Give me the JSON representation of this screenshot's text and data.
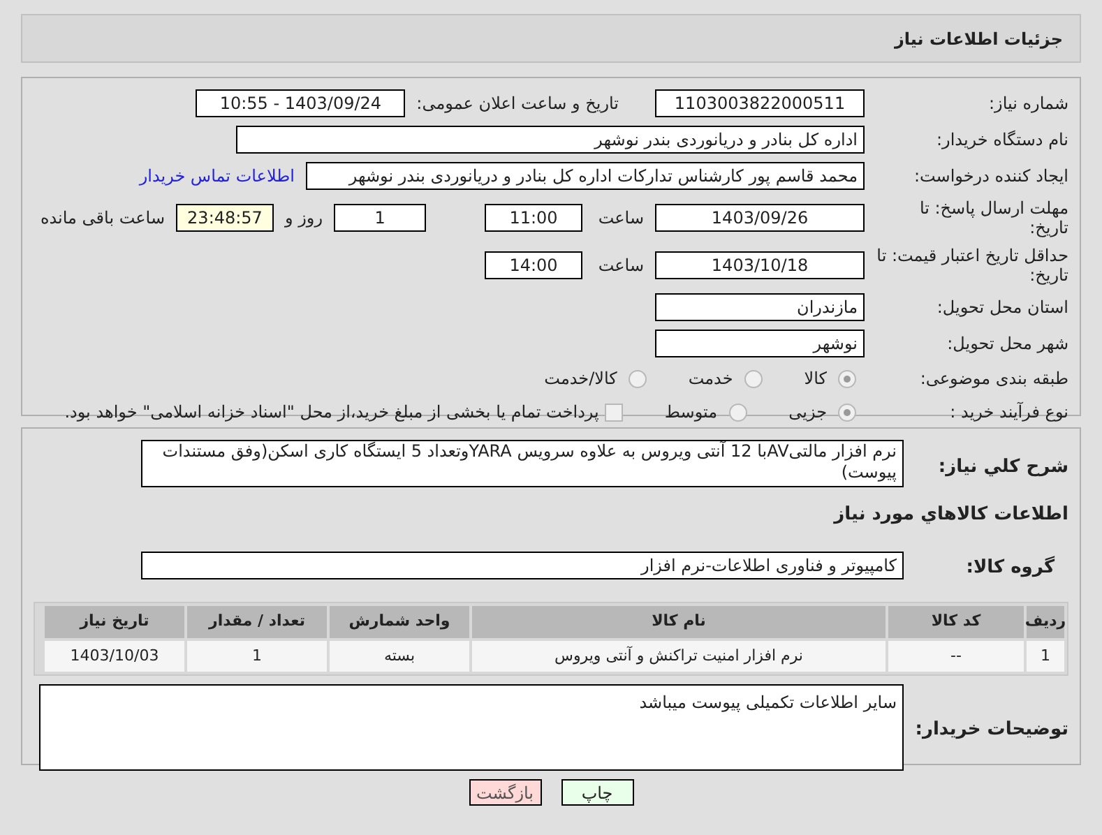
{
  "page_title": "جزئیات اطلاعات نیاز",
  "fields": {
    "need_number_label": "شماره نیاز:",
    "need_number": "1103003822000511",
    "announce_label": "تاریخ و ساعت اعلان عمومی:",
    "announce": "1403/09/24 - 10:55",
    "buyer_label": "نام دستگاه خریدار:",
    "buyer": "اداره کل بنادر و دریانوردی بندر نوشهر",
    "creator_label": "ایجاد کننده درخواست:",
    "creator": "محمد قاسم پور کارشناس تدارکات اداره کل بنادر و دریانوردی بندر نوشهر",
    "contact_link": "اطلاعات تماس خریدار",
    "deadline_label": "مهلت ارسال پاسخ: تا تاریخ:",
    "deadline_date": "1403/09/26",
    "time_label": "ساعت",
    "deadline_time": "11:00",
    "days": "1",
    "days_label": "روز و",
    "remaining": "23:48:57",
    "remaining_label": "ساعت باقی مانده",
    "validity_label": "حداقل تاریخ اعتبار قیمت: تا تاریخ:",
    "validity_date": "1403/10/18",
    "validity_time_label": "ساعت",
    "validity_time": "14:00",
    "province_label": "استان محل تحویل:",
    "province": "مازندران",
    "city_label": "شهر محل تحویل:",
    "city": "نوشهر"
  },
  "category": {
    "label": "طبقه بندی موضوعی:",
    "options": [
      {
        "label": "کالا",
        "selected": true
      },
      {
        "label": "خدمت",
        "selected": false
      },
      {
        "label": "کالا/خدمت",
        "selected": false
      }
    ]
  },
  "process": {
    "label": "نوع فرآیند خرید :",
    "options": [
      {
        "label": "جزیی",
        "selected": true
      },
      {
        "label": "متوسط",
        "selected": false
      }
    ],
    "payment_checkbox": {
      "label": "پرداخت تمام یا بخشی از مبلغ خرید،از محل \"اسناد خزانه اسلامی\" خواهد بود.",
      "checked": false
    }
  },
  "description": {
    "label": "شرح کلي نياز:",
    "value": "نرم افزار مالتیAVبا 12 آنتی ویروس به علاوه سرویس YARAوتعداد 5  ایستگاه کاری اسکن(وفق مستندات پیوست)"
  },
  "goods_heading": "اطلاعات کالاهاي مورد نياز",
  "goods_group": {
    "label": "گروه کالا:",
    "value": "کامپیوتر و فناوری اطلاعات-نرم افزار"
  },
  "table": {
    "columns": [
      "ردیف",
      "کد کالا",
      "نام کالا",
      "واحد شمارش",
      "تعداد / مقدار",
      "تاریخ نیاز"
    ],
    "rows": [
      [
        "1",
        "--",
        "نرم افزار امنیت تراکنش و آنتی ویروس",
        "بسته",
        "1",
        "1403/10/03"
      ]
    ]
  },
  "notes": {
    "label": "توضیحات خریدار:",
    "value": "سایر اطلاعات تکمیلی پیوست میباشد"
  },
  "buttons": [
    {
      "label": "چاپ",
      "kind": "print"
    },
    {
      "label": "بازگشت",
      "kind": "back"
    }
  ]
}
